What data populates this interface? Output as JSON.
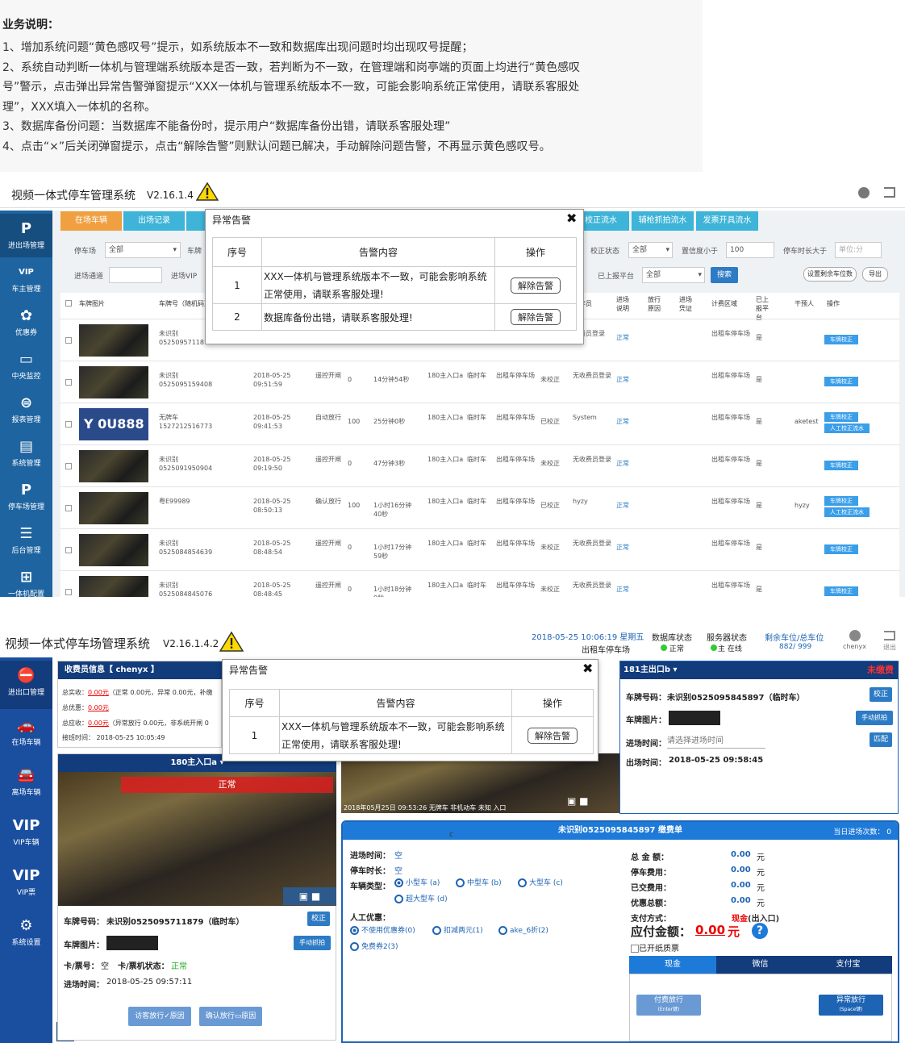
{
  "doc": {
    "heading": "业务说明：",
    "lines": [
      "1、增加系统问题“黄色感叹号”提示，如系统版本不一致和数据库出现问题时均出现叹号提醒；",
      "2、系统自动判断一体机与管理端系统版本是否一致，若判断为不一致，在管理端和岗亭端的页面上均进行“黄色感叹",
      "号”警示，点击弹出异常告警弹窗提示“XXX一体机与管理系统版本不一致，可能会影响系统正常使用，请联系客服处",
      "理”，XXX填入一体机的名称。",
      "3、数据库备份问题：当数据库不能备份时，提示用户“数据库备份出错，请联系客服处理”",
      "4、点击“×”后关闭弹窗提示，点击“解除告警”则默认问题已解决，手动解除问题告警，不再显示黄色感叹号。"
    ]
  },
  "shot1": {
    "title": "视频一体式停车管理系统",
    "version": "V2.16.1.4",
    "sidebar": [
      {
        "icon": "P",
        "label": "进出场管理"
      },
      {
        "icon": "VIP",
        "label": "车主管理"
      },
      {
        "icon": "✿",
        "label": "优惠券"
      },
      {
        "icon": "▭",
        "label": "中央监控"
      },
      {
        "icon": "⊜",
        "label": "报表管理"
      },
      {
        "icon": "▤",
        "label": "系统管理"
      },
      {
        "icon": "P",
        "label": "停车场管理"
      },
      {
        "icon": "☰",
        "label": "后台管理"
      },
      {
        "icon": "⊞",
        "label": "一体机配置"
      }
    ],
    "tabs": [
      "在场车辆",
      "出场记录",
      "校正流水",
      "辅枪抓拍流水",
      "发票开具流水"
    ],
    "filters": {
      "lot_label": "停车场",
      "lot_value": "全部",
      "plate_label": "车牌",
      "channel_label": "进场通道",
      "vip_label": "进场VIP",
      "check_label": "校正状态",
      "check_value": "全部",
      "conf_label": "置信度小于",
      "conf_value": "100",
      "dur_label": "停车时长大于",
      "dur_placeholder": "单位:分",
      "uploaded_label": "已上报平台",
      "uploaded_value": "全部",
      "search": "搜索",
      "set_btn": "设置剩余车位数",
      "export_btn": "导出"
    },
    "columns": [
      "车牌图片",
      "车牌号（随机码）",
      "操作员",
      "进场说明",
      "放行原因",
      "进场凭证",
      "计费区域",
      "已上报平台",
      "干预人",
      "操作"
    ],
    "rows": [
      {
        "plate": "未识别",
        "code": "0525095711879",
        "time": "",
        "open": "",
        "conf": "",
        "dur": "",
        "gate": "",
        "type": "",
        "area": "",
        "status": "",
        "op": "收费员登录",
        "note": "正常",
        "zone": "出租车停车场",
        "up": "是",
        "who": "",
        "btns": [
          "车牌校正"
        ]
      },
      {
        "plate": "未识别",
        "code": "0525095159408",
        "time": "2018-05-25 09:51:59",
        "open": "遥控开闸",
        "conf": "0",
        "dur": "14分钟54秒",
        "gate": "180主入口a",
        "type": "临时车",
        "area": "出租车停车场",
        "status": "未校正",
        "op": "无收费员登录",
        "note": "正常",
        "zone": "出租车停车场",
        "up": "是",
        "who": "",
        "btns": [
          "车牌校正"
        ]
      },
      {
        "plate": "无牌车",
        "code": "1527212516773",
        "time": "2018-05-25 09:41:53",
        "open": "自动放行",
        "conf": "100",
        "dur": "25分钟0秒",
        "gate": "180主入口a",
        "type": "临时车",
        "area": "出租车停车场",
        "status": "已校正",
        "op": "System",
        "note": "正常",
        "zone": "出租车停车场",
        "up": "是",
        "who": "aketest",
        "btns": [
          "车牌校正",
          "人工校正流水"
        ]
      },
      {
        "plate": "未识别",
        "code": "0525091950904",
        "time": "2018-05-25 09:19:50",
        "open": "遥控开闸",
        "conf": "0",
        "dur": "47分钟3秒",
        "gate": "180主入口a",
        "type": "临时车",
        "area": "出租车停车场",
        "status": "未校正",
        "op": "无收费员登录",
        "note": "正常",
        "zone": "出租车停车场",
        "up": "是",
        "who": "",
        "btns": [
          "车牌校正"
        ]
      },
      {
        "plate": "粤E99989",
        "code": "",
        "time": "2018-05-25 08:50:13",
        "open": "确认放行",
        "conf": "100",
        "dur": "1小时16分钟40秒",
        "gate": "180主入口a",
        "type": "临时车",
        "area": "出租车停车场",
        "status": "已校正",
        "op": "hyzy",
        "note": "正常",
        "zone": "出租车停车场",
        "up": "是",
        "who": "hyzy",
        "btns": [
          "车牌校正",
          "人工校正流水"
        ]
      },
      {
        "plate": "未识别",
        "code": "0525084854639",
        "time": "2018-05-25 08:48:54",
        "open": "遥控开闸",
        "conf": "0",
        "dur": "1小时17分钟59秒",
        "gate": "180主入口a",
        "type": "临时车",
        "area": "出租车停车场",
        "status": "未校正",
        "op": "无收费员登录",
        "note": "正常",
        "zone": "出租车停车场",
        "up": "是",
        "who": "",
        "btns": [
          "车牌校正"
        ]
      },
      {
        "plate": "未识别",
        "code": "0525084845076",
        "time": "2018-05-25 08:48:45",
        "open": "遥控开闸",
        "conf": "0",
        "dur": "1小时18分钟0秒",
        "gate": "180主入口a",
        "type": "临时车",
        "area": "出租车停车场",
        "status": "未校正",
        "op": "无收费员登录",
        "note": "正常",
        "zone": "出租车停车场",
        "up": "是",
        "who": "",
        "btns": [
          "车牌校正"
        ]
      }
    ],
    "plate_chars": "Y 0U888",
    "modal": {
      "title": "异常告警",
      "h_no": "序号",
      "h_content": "告警内容",
      "h_op": "操作",
      "rows": [
        {
          "no": "1",
          "text": "XXX一体机与管理系统版本不一致，可能会影响系统正常使用，请联系客服处理!",
          "btn": "解除告警"
        },
        {
          "no": "2",
          "text": "数据库备份出错，请联系客服处理!",
          "btn": "解除告警"
        }
      ]
    }
  },
  "shot2": {
    "title": "视频一体式停车场管理系统",
    "version": "V2.16.1.4.2",
    "datetime": "2018-05-25 10:06:19 星期五",
    "lot": "出租车停车场",
    "db_label": "数据库状态",
    "db_status": "正常",
    "server_label": "服务器状态",
    "server_status": "主 在线",
    "spaces_label": "剩余车位/总车位",
    "spaces_value": "882/ 999",
    "user": "chenyx",
    "logout": "退出",
    "sidebar": [
      {
        "icon": "⛔",
        "label": "进出口管理"
      },
      {
        "icon": "🚗",
        "label": "在场车辆"
      },
      {
        "icon": "🚘",
        "label": "离场车辆"
      },
      {
        "icon": "VIP",
        "label": "VIP车辆"
      },
      {
        "icon": "VIP",
        "label": "VIP票"
      },
      {
        "icon": "⚙",
        "label": "系统设置"
      }
    ],
    "cashier": {
      "title": "收费员信息【 chenyx 】",
      "l1": "总实收：",
      "v1": "0.00元",
      "t1": "（正常 0.00元，异常 0.00元，补缴",
      "l2": "总优惠：",
      "v2": "0.00元",
      "l3": "总应收：",
      "v3": "0.00元",
      "t3": "（异常放行 0.00元，非系统开闸 0",
      "shift": "接班时间：   2018-05-25 10:05:49"
    },
    "cam1": {
      "title": "180主入口a ▾",
      "overlay": "正常",
      "plate_label": "车牌号码：",
      "plate_value": "未识别0525095711879（临时车）",
      "fix_btn": "校正",
      "img_label": "车牌图片：",
      "capture_btn": "手动抓拍",
      "card_label": "卡/票号：",
      "card_value": "空",
      "cardstat_label": "卡/票机状态：",
      "cardstat_value": "正常",
      "enter_label": "进场时间：",
      "enter_value": "2018-05-25 09:57:11",
      "btn_visitor": "访客放行",
      "btn_confirm": "确认放行",
      "reason": "原因"
    },
    "cam2": {
      "osd": "2018年05月25日  09:53:26  无牌车  非机动车  未知  入口"
    },
    "exit": {
      "title": "181主出口b ▾",
      "status": "未缴费",
      "plate_label": "车牌号码：",
      "plate_value": "未识别0525095845897（临时车）",
      "fix_btn": "校正",
      "img_label": "车牌图片：",
      "capture_btn": "手动抓拍",
      "enter_label": "进场时间：",
      "enter_placeholder": "请选择进场时间",
      "match_btn": "匹配",
      "exit_label": "出场时间：",
      "exit_value": "2018-05-25 09:58:45"
    },
    "bill": {
      "title": "未识别0525095845897  缴费单",
      "count": "当日进场次数：  0",
      "c": "c",
      "in_label": "进场时间：",
      "in_value": "空",
      "stay_label": "停车时长：",
      "stay_value": "空",
      "type_label": "车辆类型：",
      "types": [
        "小型车 (a)",
        "中型车 (b)",
        "大型车 (c)",
        "超大型车 (d)"
      ],
      "disc_label": "人工优惠：",
      "discs": [
        "不使用优惠券(0)",
        "扣减两元(1)",
        "ake_6折(2)",
        "免费券2(3)"
      ],
      "total_label": "总 金 额：",
      "total": "0.00",
      "fee_label": "停车费用：",
      "fee": "0.00",
      "paid_label": "已交费用：",
      "paid": "0.00",
      "disc_total_label": "优惠总额：",
      "disc_total": "0.00",
      "yuan": "元",
      "pay_label": "支付方式：",
      "pay_value": "现金",
      "pay_sub": "(出入口)",
      "due_label": "应付金额：",
      "due": "0.00",
      "due_unit": "元",
      "invoice": "已开纸质票",
      "ptabs": [
        "现金",
        "微信",
        "支付宝"
      ],
      "pay_btn": "付费放行",
      "pay_key": "(Enter键)",
      "abn_btn": "异常放行",
      "abn_key": "(Space键)"
    },
    "modal": {
      "title": "异常告警",
      "h_no": "序号",
      "h_content": "告警内容",
      "h_op": "操作",
      "row": {
        "no": "1",
        "text": "XXX一体机与管理系统版本不一致，可能会影响系统正常使用，请联系客服处理!",
        "btn": "解除告警"
      }
    }
  }
}
